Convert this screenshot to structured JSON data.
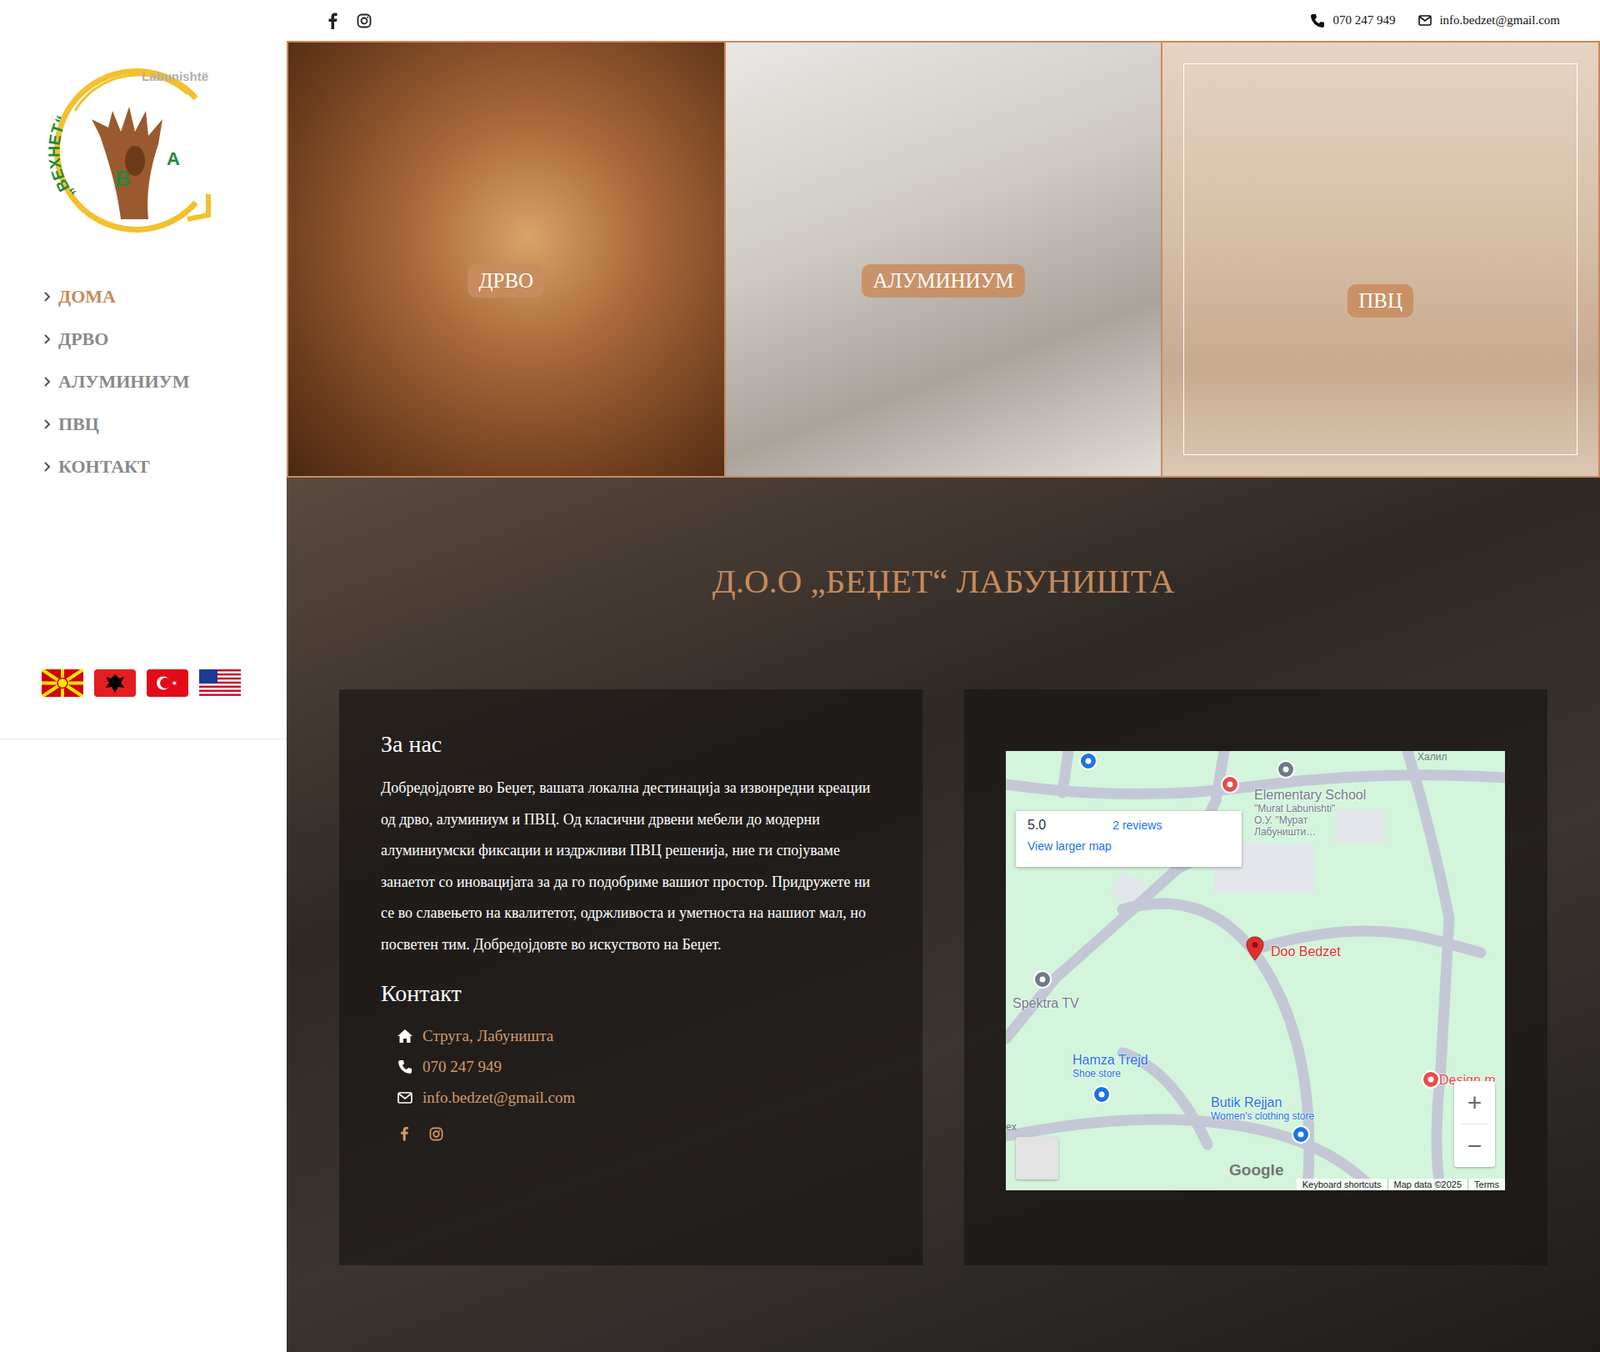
{
  "topbar": {
    "phone": "070 247 949",
    "email": "info.bedzet@gmail.com"
  },
  "logo": {
    "top": "Labunishtë",
    "arc": "„BEXHET“",
    "left": "B",
    "right": "A"
  },
  "nav": [
    {
      "label": "ДОМА",
      "selected": true
    },
    {
      "label": "ДРВО",
      "selected": false
    },
    {
      "label": "АЛУМИНИУМ",
      "selected": false
    },
    {
      "label": "ПВЦ",
      "selected": false
    },
    {
      "label": "КОНТАКТ",
      "selected": false
    }
  ],
  "flags": [
    {
      "kind": "mk"
    },
    {
      "kind": "al"
    },
    {
      "kind": "tr"
    },
    {
      "kind": "us"
    }
  ],
  "hero": [
    {
      "label": "ДРВО",
      "kind": "wood",
      "highlighted": false
    },
    {
      "label": "АЛУМИНИУМ",
      "kind": "aluminium",
      "highlighted": false
    },
    {
      "label": "ПВЦ",
      "kind": "pvc",
      "highlighted": true
    }
  ],
  "title": "Д.О.О „БЕЏЕТ“ ЛАБУНИШТА",
  "about": {
    "heading": "За нас",
    "text": "Добредојдовте во Беџет, вашата локална дестинација за извонредни креации од дрво, алуминиум и ПВЦ. Од класични дрвени мебели до модерни алуминиумски фиксации и издржливи ПВЦ решенија, ние ги спојуваме занаетот со иновацијата за да го подобриме вашиот простор. Придружете ни се во славењето на квалитетот, одржливоста и уметноста на нашиот мал, но посветен тим. Добредојдовте во искуството на Беџет."
  },
  "contact": {
    "heading": "Контакт",
    "items": [
      {
        "kind": "address",
        "text": "Струга, Лабуништа"
      },
      {
        "kind": "phone",
        "text": "070 247 949"
      },
      {
        "kind": "email",
        "text": "info.bedzet@gmail.com"
      }
    ]
  },
  "map": {
    "rating": "5.0",
    "reviews": "2 reviews",
    "larger": "View larger map",
    "places": [
      {
        "lines": [],
        "color": "#1a73e8"
      },
      {
        "lines": [],
        "color": "#e94b4b"
      },
      {
        "lines": [
          "Elementary School",
          "\"Murat Labunishti\"",
          "О.У. \"Мурат",
          "Лабуништи…"
        ],
        "color": "#6d7a86"
      },
      {
        "lines": [
          "Doo Bedzet"
        ],
        "color": "#e0302c"
      },
      {
        "lines": [
          "Spektra TV"
        ],
        "color": "#6d7a86"
      },
      {
        "lines": [
          "Hamza Trejd",
          "Shoe store"
        ],
        "color": "#1a73e8"
      },
      {
        "lines": [
          "Butik Rejjan",
          "Women's clothing store"
        ],
        "color": "#1a73e8"
      },
      {
        "lines": [
          "Design m"
        ],
        "color": "#e94b4b"
      }
    ],
    "edge_labels": [
      "Халил",
      "ex"
    ],
    "zoom_in": "+",
    "zoom_out": "−",
    "brand": "Google",
    "footer": [
      "Keyboard shortcuts",
      "Map data ©2025",
      "Terms"
    ]
  }
}
